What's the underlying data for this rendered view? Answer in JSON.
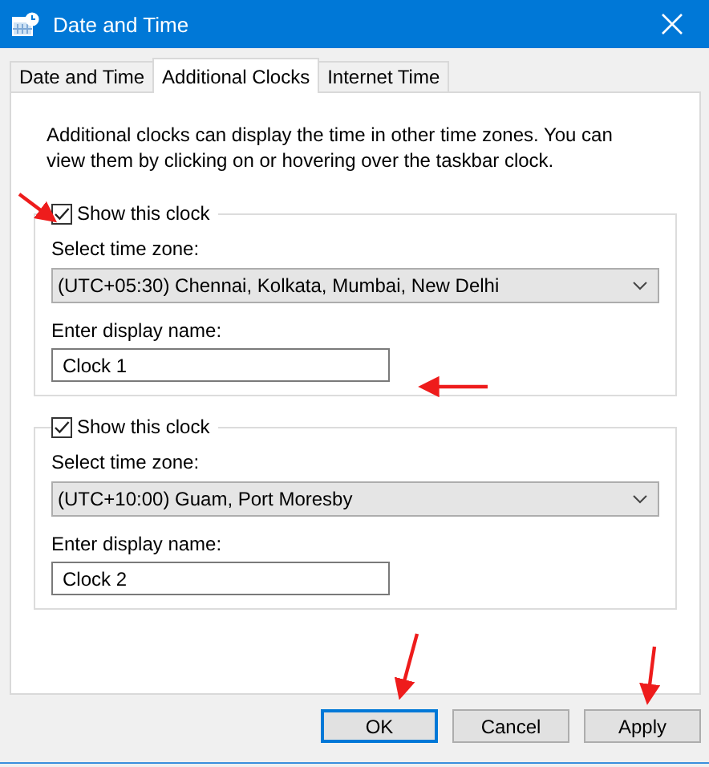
{
  "window": {
    "title": "Date and Time"
  },
  "tabs": [
    {
      "label": "Date and Time",
      "selected": false
    },
    {
      "label": "Additional Clocks",
      "selected": true
    },
    {
      "label": "Internet Time",
      "selected": false
    }
  ],
  "description": "Additional clocks can display the time in other time zones. You can view them by clicking on or hovering over the taskbar clock.",
  "clocks": [
    {
      "show_label": "Show this clock",
      "checked": true,
      "zone_label": "Select time zone:",
      "zone": "(UTC+05:30) Chennai, Kolkata, Mumbai, New Delhi",
      "name_label": "Enter display name:",
      "name": "Clock 1"
    },
    {
      "show_label": "Show this clock",
      "checked": true,
      "zone_label": "Select time zone:",
      "zone": "(UTC+10:00) Guam, Port Moresby",
      "name_label": "Enter display name:",
      "name": "Clock 2"
    }
  ],
  "buttons": [
    {
      "label": "OK",
      "default": true
    },
    {
      "label": "Cancel",
      "default": false
    },
    {
      "label": "Apply",
      "default": false
    }
  ]
}
